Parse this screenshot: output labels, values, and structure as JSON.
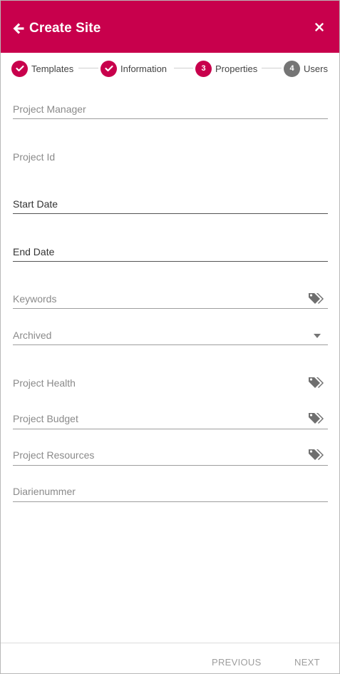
{
  "header": {
    "title": "Create Site",
    "back_icon": "arrow-left-icon",
    "close_icon": "close-icon",
    "background": "#c8004c"
  },
  "stepper": {
    "steps": [
      {
        "label": "Templates",
        "state": "done",
        "marker": ""
      },
      {
        "label": "Information",
        "state": "done",
        "marker": ""
      },
      {
        "label": "Properties",
        "state": "active",
        "marker": "3"
      },
      {
        "label": "Users",
        "state": "todo",
        "marker": "4"
      }
    ]
  },
  "fields": {
    "project_manager": {
      "label": "Project Manager"
    },
    "project_id": {
      "label": "Project Id"
    },
    "start_date": {
      "label": "Start Date"
    },
    "end_date": {
      "label": "End Date"
    },
    "keywords": {
      "label": "Keywords",
      "icon": "tag-icon"
    },
    "archived": {
      "label": "Archived",
      "icon": "caret-down-icon"
    },
    "project_health": {
      "label": "Project Health",
      "icon": "tag-icon"
    },
    "project_budget": {
      "label": "Project Budget",
      "icon": "tag-icon"
    },
    "project_resources": {
      "label": "Project Resources",
      "icon": "tag-icon"
    },
    "diarienummer": {
      "label": "Diarienummer"
    }
  },
  "footer": {
    "previous_label": "PREVIOUS",
    "next_label": "NEXT"
  },
  "colors": {
    "accent": "#c8004c",
    "inactive_step": "#757575",
    "placeholder": "#8a8a8a",
    "disabled_button": "#9e9e9e"
  }
}
